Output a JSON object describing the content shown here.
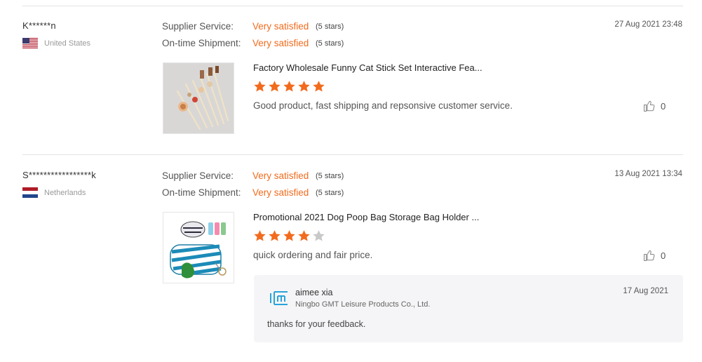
{
  "reviews": [
    {
      "username": "K******n",
      "country": "United States",
      "flag": "us-flag",
      "supplier_service_label": "Supplier Service:",
      "supplier_service_value": "Very satisfied",
      "supplier_service_stars": "(5 stars)",
      "shipment_label": "On-time Shipment:",
      "shipment_value": "Very satisfied",
      "shipment_stars": "(5 stars)",
      "date": "27 Aug 2021 23:48",
      "product_title": "Factory Wholesale Funny Cat Stick Set Interactive Fea...",
      "rating": 5,
      "comment": "Good product, fast shipping and repsonsive customer service.",
      "likes": "0"
    },
    {
      "username": "S*****************k",
      "country": "Netherlands",
      "flag": "nl-flag",
      "supplier_service_label": "Supplier Service:",
      "supplier_service_value": "Very satisfied",
      "supplier_service_stars": "(5 stars)",
      "shipment_label": "On-time Shipment:",
      "shipment_value": "Very satisfied",
      "shipment_stars": "(5 stars)",
      "date": "13 Aug 2021 13:34",
      "product_title": "Promotional 2021 Dog Poop Bag Storage Bag Holder ...",
      "rating": 4,
      "comment": "quick ordering and fair price.",
      "likes": "0",
      "reply": {
        "name": "aimee xia",
        "company": "Ningbo GMT Leisure Products Co., Ltd.",
        "date": "17 Aug 2021",
        "text": "thanks for your feedback."
      }
    }
  ],
  "colors": {
    "accent": "#f26b1d",
    "star_empty": "#c8c8c8",
    "divider": "#e3e3e3"
  }
}
